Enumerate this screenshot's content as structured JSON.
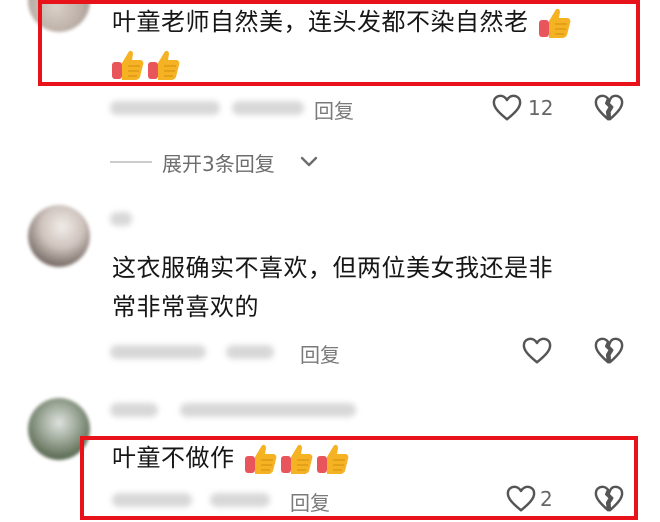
{
  "comments": [
    {
      "text": "叶童老师自然美，连头发都不染自然老",
      "thumbs_count": 3,
      "reply_label": "回复",
      "like_count": "12"
    },
    {
      "text_line1": "这衣服确实不喜欢，但两位美女我还是非",
      "text_line2": "常非常喜欢的",
      "reply_label": "回复"
    },
    {
      "text": "叶童不做作",
      "thumbs_count": 3,
      "reply_label": "回复",
      "like_count": "2"
    }
  ],
  "expand_replies": {
    "label": "展开3条回复"
  },
  "icons": {
    "like": "heart-outline-icon",
    "dislike": "broken-heart-icon",
    "emoji": "thumbs-up-icon",
    "expand": "chevron-down-icon"
  },
  "colors": {
    "highlight_box": "#e8121b",
    "thumb_fill": "#f5a623",
    "text": "#161616",
    "muted": "#8a8a8a"
  }
}
